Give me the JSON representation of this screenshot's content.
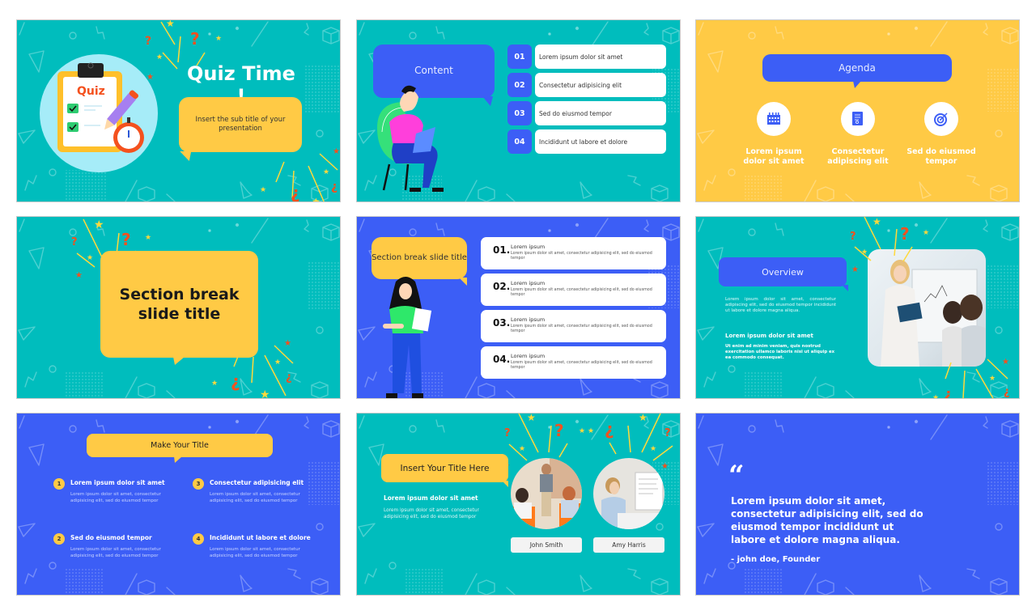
{
  "colors": {
    "teal": "#00bdbd",
    "blue": "#3c5ef6",
    "yellow": "#ffca45",
    "orange_accent": "#f4511e",
    "white": "#ffffff"
  },
  "slides": {
    "quiz_title": {
      "clipboard_label": "Quiz",
      "title": "Quiz Time !",
      "subtitle": "Insert the sub title of your presentation"
    },
    "content": {
      "bubble_label": "Content",
      "items": [
        {
          "num": "01",
          "text": "Lorem ipsum dolor sit amet"
        },
        {
          "num": "02",
          "text": "Consectetur adipisicing elit"
        },
        {
          "num": "03",
          "text": "Sed do eiusmod tempor"
        },
        {
          "num": "04",
          "text": "Incididunt ut labore et dolore"
        }
      ]
    },
    "agenda": {
      "title": "Agenda",
      "items": [
        {
          "icon": "calendar-icon",
          "label": "Lorem ipsum dolor sit amet"
        },
        {
          "icon": "document-icon",
          "label": "Consectetur adipiscing elit"
        },
        {
          "icon": "target-icon",
          "label": "Sed do eiusmod tempor"
        }
      ]
    },
    "section_break": {
      "title": "Section break slide title"
    },
    "section_list": {
      "bubble_label": "Section break slide title",
      "items": [
        {
          "num": "01.",
          "heading": "Lorem ipsum",
          "body": "Lorem ipsum dolor sit amet, consectetur adipisicing elit, sed do eiusmod tempor"
        },
        {
          "num": "02.",
          "heading": "Lorem ipsum",
          "body": "Lorem ipsum dolor sit amet, consectetur adipisicing elit, sed do eiusmod tempor"
        },
        {
          "num": "03.",
          "heading": "Lorem ipsum",
          "body": "Lorem ipsum dolor sit amet, consectetur adipisicing elit, sed do eiusmod tempor"
        },
        {
          "num": "04.",
          "heading": "Lorem ipsum",
          "body": "Lorem ipsum dolor sit amet, consectetur adipisicing elit, sed do eiusmod tempor"
        }
      ]
    },
    "overview": {
      "title": "Overview",
      "paragraph": "Lorem ipsum dolor sit amet, consectetur adipiscing elit, sed do eiusmod tempor incididunt ut labore et dolore magna aliqua.",
      "subheading": "Lorem ipsum dolor sit amet",
      "subparagraph": "Ut enim ad minim veniam, quis nostrud exercitation ullamco laboris nisi ut aliquip ex ea commodo consequat."
    },
    "make_title": {
      "title": "Make Your Title",
      "items": [
        {
          "num": "1",
          "heading": "Lorem ipsum dolor sit amet",
          "body": "Lorem ipsum dolor sit amet, consectetur adipisicing elit, sed do eiusmod tempor"
        },
        {
          "num": "2",
          "heading": "Sed do eiusmod tempor",
          "body": "Lorem ipsum dolor sit amet, consectetur adipisicing elit, sed do eiusmod tempor"
        },
        {
          "num": "3",
          "heading": "Consectetur adipisicing elit",
          "body": "Lorem ipsum dolor sit amet, consectetur adipisicing elit, sed do eiusmod tempor"
        },
        {
          "num": "4",
          "heading": "Incididunt ut labore et dolore",
          "body": "Lorem ipsum dolor sit amet, consectetur adipisicing elit, sed do eiusmod tempor"
        }
      ]
    },
    "team": {
      "title": "Insert Your Title Here",
      "heading": "Lorem ipsum dolor sit amet",
      "body": "Lorem ipsum dolor sit amet, consectetur adipisicing elit, sed do eiusmod tempor",
      "members": [
        {
          "name": "John Smith"
        },
        {
          "name": "Amy Harris"
        }
      ]
    },
    "quote": {
      "quote_mark": "“",
      "text": "Lorem ipsum dolor sit amet, consectetur adipisicing elit, sed do eiusmod tempor incididunt ut labore et dolore magna aliqua.",
      "author": "- john doe, Founder"
    }
  }
}
